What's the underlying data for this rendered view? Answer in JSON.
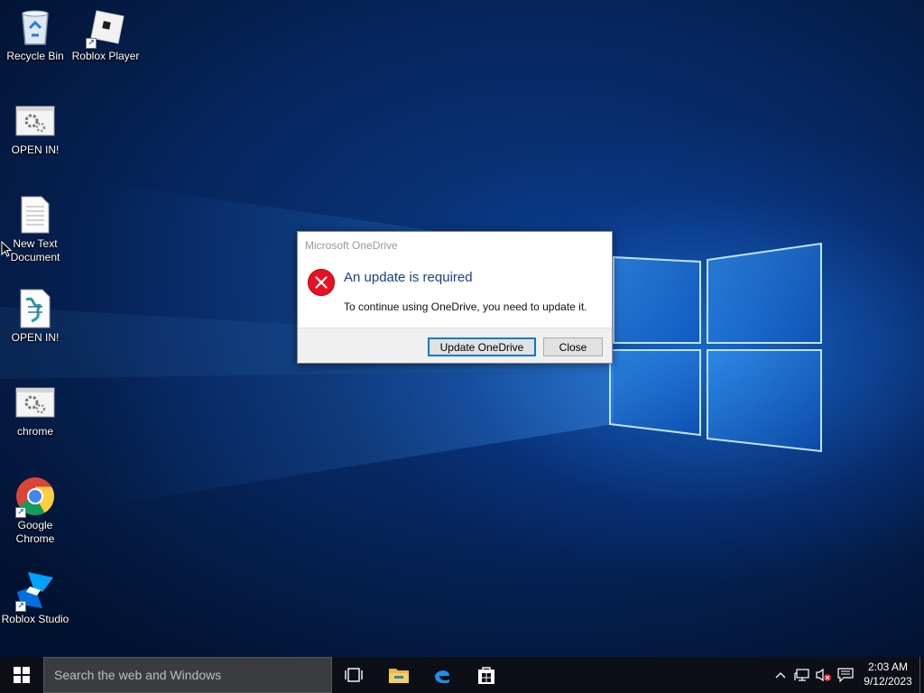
{
  "desktop": {
    "icons": [
      {
        "label": "Recycle Bin",
        "icon": "recycle-bin-icon"
      },
      {
        "label": "Roblox Player",
        "icon": "roblox-player-icon",
        "shortcut": true
      },
      {
        "label": "OPEN IN!",
        "icon": "settings-app-icon"
      },
      {
        "label": "New Text Document",
        "icon": "text-document-icon"
      },
      {
        "label": "OPEN IN!",
        "icon": "script-icon"
      },
      {
        "label": "chrome",
        "icon": "settings-app-icon"
      },
      {
        "label": "Google Chrome",
        "icon": "chrome-icon",
        "shortcut": true
      },
      {
        "label": "Roblox Studio",
        "icon": "roblox-studio-icon",
        "shortcut": true
      }
    ]
  },
  "dialog": {
    "title": "Microsoft OneDrive",
    "heading": "An update is required",
    "body": "To continue using OneDrive, you need to update it.",
    "primary_button": "Update OneDrive",
    "close_button": "Close",
    "icon": "error-icon",
    "accent_color": "#1a3f8f",
    "error_color": "#e81123"
  },
  "taskbar": {
    "search_placeholder": "Search the web and Windows",
    "pinned": [
      "task-view-icon",
      "file-explorer-icon",
      "edge-icon",
      "store-icon"
    ],
    "tray": [
      "chevron-up-icon",
      "network-icon",
      "volume-muted-icon",
      "action-center-icon"
    ],
    "time": "2:03 AM",
    "date": "9/12/2023"
  }
}
